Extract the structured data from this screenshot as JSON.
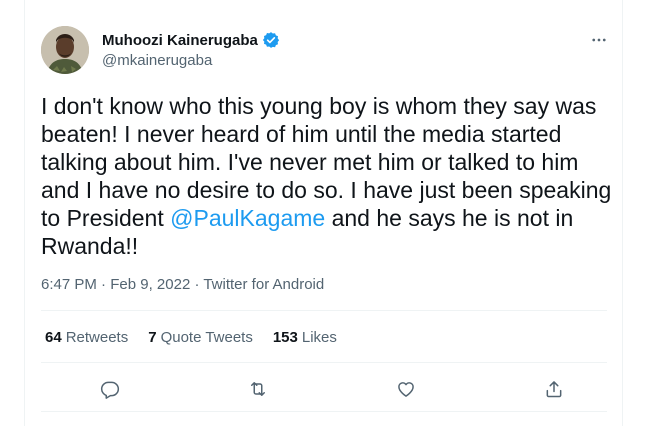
{
  "author": {
    "name": "Muhoozi Kainerugaba",
    "handle": "@mkainerugaba",
    "verified": true
  },
  "tweet": {
    "text_before": "I don't know who this young boy is whom they say was beaten! I never heard of him until the media started talking about him. I've never met him or talked to him and I have no desire to do so. I have just been speaking to President ",
    "mention": "@PaulKagame",
    "text_after": " and he says he is not in Rwanda!!"
  },
  "meta": {
    "time": "6:47 PM",
    "separator1": " · ",
    "date": "Feb 9, 2022",
    "separator2": " · ",
    "source": "Twitter for Android"
  },
  "stats": [
    {
      "count": "64",
      "label": "Retweets"
    },
    {
      "count": "7",
      "label": "Quote Tweets"
    },
    {
      "count": "153",
      "label": "Likes"
    }
  ],
  "actions": [
    "reply-icon",
    "retweet-icon",
    "like-icon",
    "share-icon"
  ],
  "colors": {
    "accent": "#1d9bf0",
    "text": "#0f1419",
    "secondary": "#536471",
    "divider": "#eff3f4"
  }
}
